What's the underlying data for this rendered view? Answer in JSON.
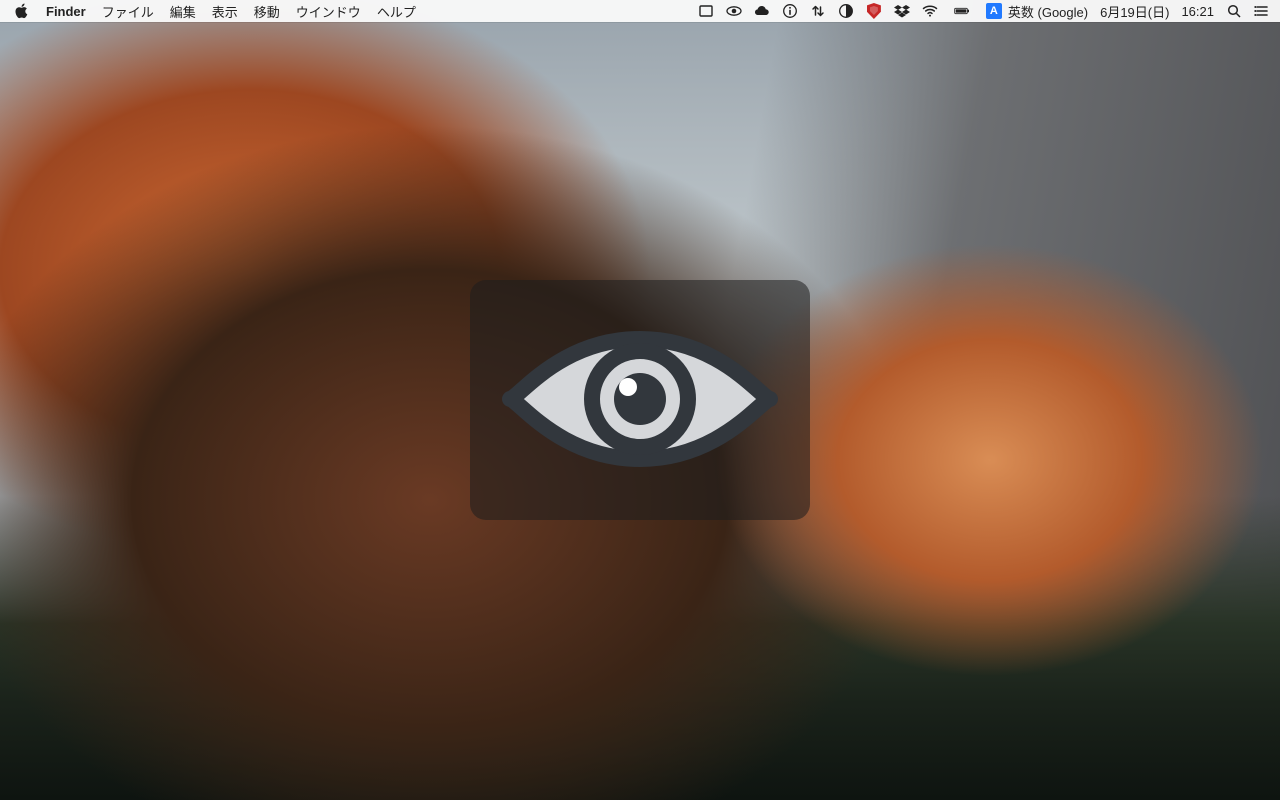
{
  "menubar": {
    "app_name": "Finder",
    "items": [
      "ファイル",
      "編集",
      "表示",
      "移動",
      "ウインドウ",
      "ヘルプ"
    ],
    "ime_badge_letter": "A",
    "ime_label": "英数 (Google)",
    "date": "6月19日(日)",
    "time": "16:21"
  },
  "status_icons": [
    "rectangle-icon",
    "preview-eye-icon",
    "cloud-icon",
    "info-icon",
    "updown-arrows-icon",
    "contrast-icon",
    "antivirus-shield-icon",
    "dropbox-icon",
    "wifi-icon",
    "battery-icon"
  ],
  "overlay": {
    "icon": "eye-icon"
  }
}
